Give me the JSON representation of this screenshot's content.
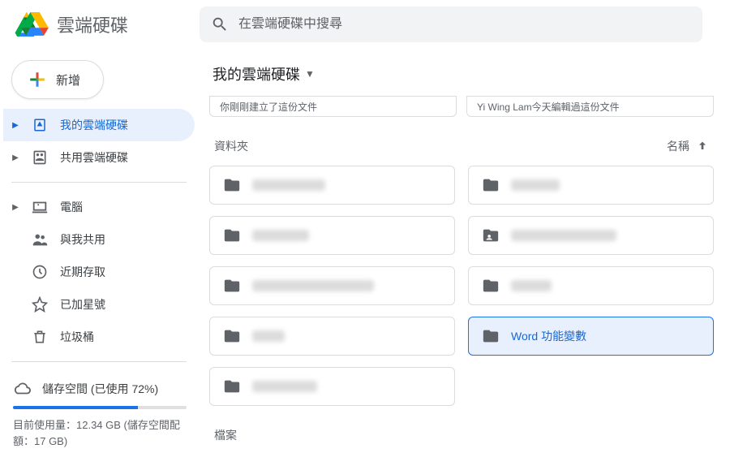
{
  "header": {
    "app_title": "雲端硬碟",
    "search_placeholder": "在雲端硬碟中搜尋"
  },
  "sidebar": {
    "new_label": "新增",
    "items": [
      {
        "label": "我的雲端硬碟",
        "active": true,
        "has_caret": true,
        "icon": "drive-icon"
      },
      {
        "label": "共用雲端硬碟",
        "active": false,
        "has_caret": true,
        "icon": "shared-drives-icon"
      },
      {
        "label": "電腦",
        "active": false,
        "has_caret": true,
        "icon": "computer-icon",
        "group": 2
      },
      {
        "label": "與我共用",
        "active": false,
        "has_caret": false,
        "icon": "shared-with-me-icon",
        "group": 2
      },
      {
        "label": "近期存取",
        "active": false,
        "has_caret": false,
        "icon": "recent-icon",
        "group": 2
      },
      {
        "label": "已加星號",
        "active": false,
        "has_caret": false,
        "icon": "starred-icon",
        "group": 2
      },
      {
        "label": "垃圾桶",
        "active": false,
        "has_caret": false,
        "icon": "trash-icon",
        "group": 2
      }
    ],
    "storage": {
      "label": "儲存空間 (已使用 72%)",
      "percent": 72,
      "line": "目前使用量：12.34 GB (儲存空間配額：17 GB)"
    }
  },
  "main": {
    "breadcrumb": "我的雲端硬碟",
    "suggestions": [
      "你剛剛建立了這份文件",
      "Yi Wing Lam今天編輯過這份文件"
    ],
    "folders_heading": "資料夾",
    "sort_label": "名稱",
    "folders": [
      {
        "name": "",
        "blurred": true,
        "blur_w": 90,
        "icon": "folder"
      },
      {
        "name": "",
        "blurred": true,
        "blur_w": 60,
        "icon": "folder"
      },
      {
        "name": "",
        "blurred": true,
        "blur_w": 70,
        "icon": "folder"
      },
      {
        "name": "",
        "blurred": true,
        "blur_w": 130,
        "icon": "folder-shared"
      },
      {
        "name": "",
        "blurred": true,
        "blur_w": 150,
        "icon": "folder"
      },
      {
        "name": "",
        "blurred": true,
        "blur_w": 50,
        "icon": "folder"
      },
      {
        "name": "",
        "blurred": true,
        "blur_w": 40,
        "icon": "folder"
      },
      {
        "name": "Word 功能變數",
        "blurred": false,
        "selected": true,
        "icon": "folder"
      },
      {
        "name": "",
        "blurred": true,
        "blur_w": 80,
        "icon": "folder"
      }
    ],
    "files_heading": "檔案"
  }
}
